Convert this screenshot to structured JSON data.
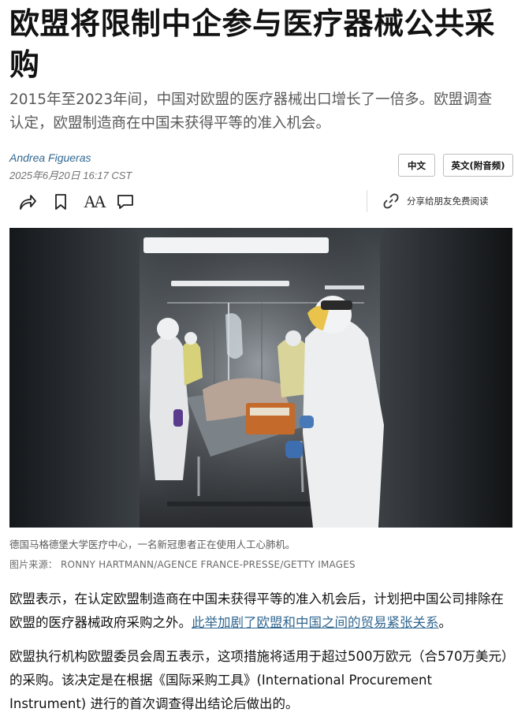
{
  "article": {
    "headline": "欧盟将限制中企参与医疗器械公共采购",
    "summary": "2015年至2023年间，中国对欧盟的医疗器械出口增长了一倍多。欧盟调查认定，欧盟制造商在中国未获得平等的准入机会。",
    "author": "Andrea Figueras",
    "date": "2025年6月20日 16:17 CST"
  },
  "lang_buttons": {
    "zh": "中文",
    "en": "英文(附音频)"
  },
  "toolbar": {
    "share_icon": "share-arrow-icon",
    "bookmark_icon": "bookmark-icon",
    "font_size_label": "AA",
    "comment_icon": "comment-icon",
    "gift_label": "分享给朋友免费阅读"
  },
  "image": {
    "caption": "德国马格德堡大学医疗中心，一名新冠患者正在使用人工心肺机。",
    "credit": "图片来源： RONNY HARTMANN/AGENCE FRANCE-PRESSE/GETTY IMAGES"
  },
  "body": {
    "p1_text": "欧盟表示，在认定欧盟制造商在中国未获得平等的准入机会后，计划把中国公司排除在欧盟的医疗器械政府采购之外。",
    "p1_link": "此举加剧了欧盟和中国之间的贸易紧张关系",
    "p1_end": "。",
    "p2_text": "欧盟执行机构欧盟委员会周五表示，这项措施将适用于超过500万欧元（合570万美元）的采购。该决定是在根据《国际采购工具》(International Procurement Instrument) 进行的首次调查得出结论后做出的。"
  }
}
